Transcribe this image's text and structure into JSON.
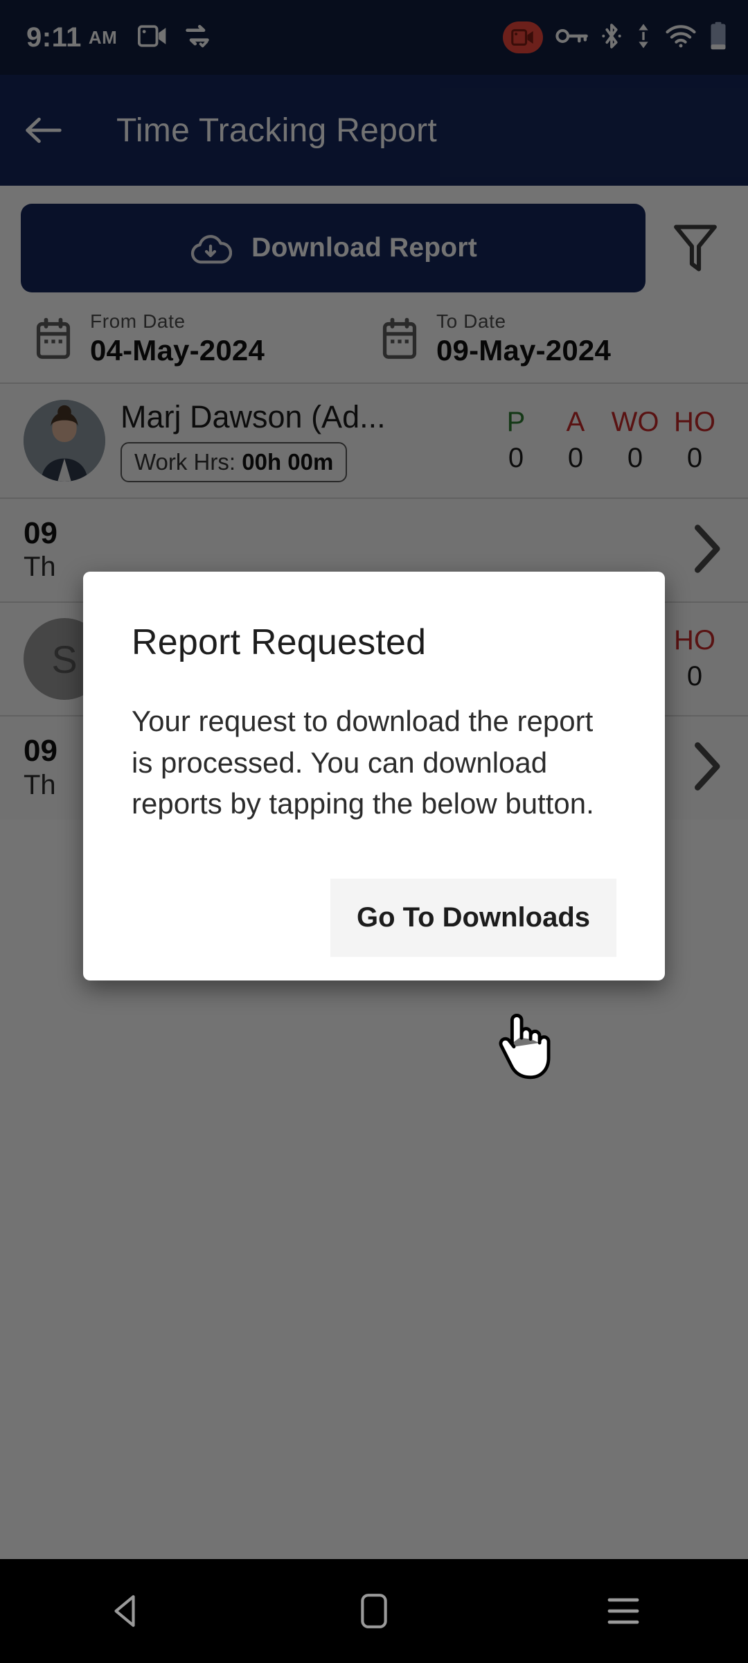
{
  "statusbar": {
    "time": "9:11",
    "ampm": "AM",
    "icons_left": [
      "video-call-icon",
      "vpn-sync-icon"
    ],
    "icons_right": [
      "screen-recording-icon",
      "vpn-key-icon",
      "bluetooth-icon",
      "data-transfer-icon",
      "wifi-icon",
      "battery-icon"
    ],
    "recording_color": "#f0483c",
    "background": "#101e3f"
  },
  "appbar": {
    "title": "Time Tracking Report",
    "back_icon": "back-arrow-icon",
    "background": "#16275c"
  },
  "toolbar": {
    "download_label": "Download Report",
    "download_icon": "cloud-download-icon",
    "filter_icon": "filter-funnel-icon",
    "button_color": "#16275c"
  },
  "dates": {
    "from": {
      "label": "From Date",
      "value": "04-May-2024",
      "icon": "calendar-icon"
    },
    "to": {
      "label": "To Date",
      "value": "09-May-2024",
      "icon": "calendar-icon"
    }
  },
  "employees": [
    {
      "name": "Marj Dawson (Ad...",
      "work_hours_label": "Work Hrs:",
      "work_hours_value": "00h 00m",
      "avatar": "user-avatar",
      "stats": [
        {
          "key": "P",
          "value": "0",
          "color": "#2e7d32"
        },
        {
          "key": "A",
          "value": "0",
          "color": "#c62828"
        },
        {
          "key": "WO",
          "value": "0",
          "color": "#c62828"
        },
        {
          "key": "HO",
          "value": "0",
          "color": "#c62828"
        }
      ]
    },
    {
      "name": "S",
      "avatar": "user-avatar-initial",
      "stats": [
        {
          "key": "HO",
          "value": "0",
          "color": "#c62828"
        }
      ]
    }
  ],
  "day_rows": [
    {
      "day_number": "09",
      "day_name": "Th",
      "chevron": "chevron-right-icon"
    },
    {
      "day_number": "09",
      "day_name": "Th",
      "chevron": "chevron-right-icon"
    }
  ],
  "dialog": {
    "title": "Report Requested",
    "body": "Your request to download the report is processed. You can download reports by tapping the below button.",
    "button_label": "Go To Downloads",
    "button_background": "#f4f4f4"
  },
  "navbar": {
    "back": "nav-back-icon",
    "home": "nav-home-icon",
    "recents": "nav-recents-icon"
  }
}
